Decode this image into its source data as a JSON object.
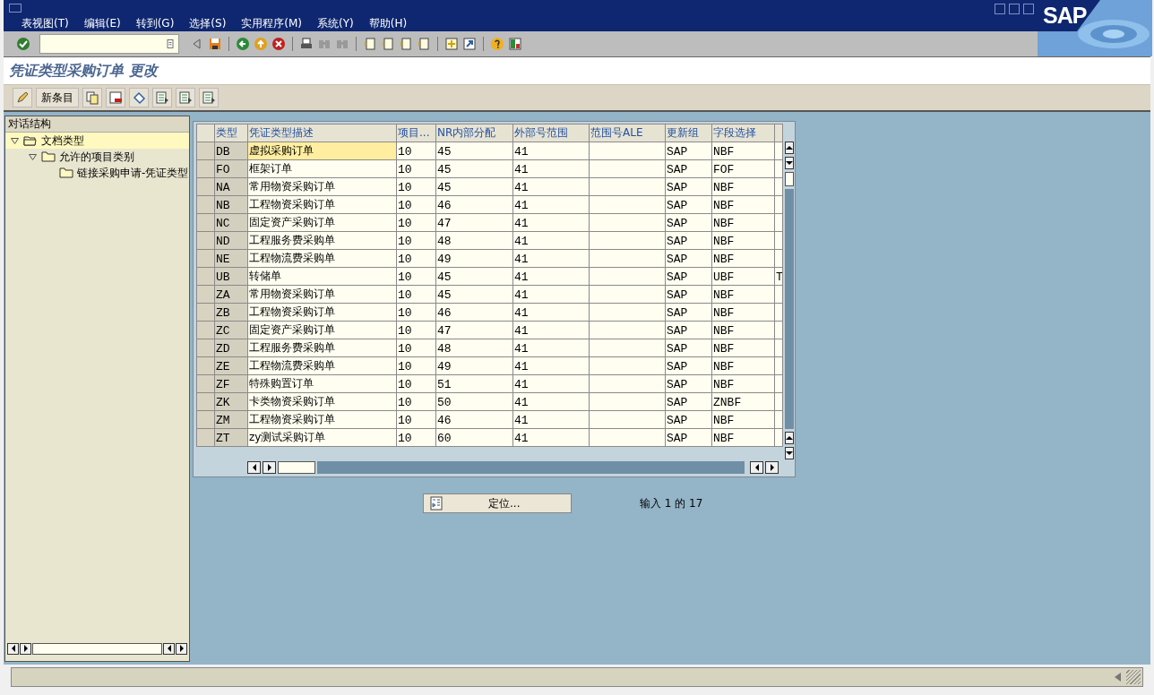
{
  "logo": "SAP",
  "menu": [
    "表视图(T)",
    "编辑(E)",
    "转到(G)",
    "选择(S)",
    "实用程序(M)",
    "系统(Y)",
    "帮助(H)"
  ],
  "title": "凭证类型采购订单 更改",
  "app_toolbar": {
    "button_label": "新条目"
  },
  "tree": {
    "title": "对话结构",
    "nodes": [
      {
        "label": "文档类型",
        "selected": true,
        "expanded": true,
        "children": [
          {
            "label": "允许的项目类别",
            "selected": false,
            "expanded": true,
            "children": [
              {
                "label": "链接采购申请-凭证类型",
                "selected": false
              }
            ]
          }
        ]
      }
    ]
  },
  "table": {
    "columns": [
      "类型",
      "凭证类型描述",
      "项目...",
      "NR内部分配",
      "外部号范围",
      "范围号ALE",
      "更新组",
      "字段选择"
    ],
    "rows": [
      {
        "cells": [
          "DB",
          "虚拟采购订单",
          "10",
          "45",
          "41",
          "",
          "SAP",
          "NBF",
          ""
        ],
        "focused": true
      },
      {
        "cells": [
          "FO",
          "框架订单",
          "10",
          "45",
          "41",
          "",
          "SAP",
          "FOF",
          ""
        ],
        "focused": false
      },
      {
        "cells": [
          "NA",
          "常用物资采购订单",
          "10",
          "45",
          "41",
          "",
          "SAP",
          "NBF",
          ""
        ],
        "focused": false
      },
      {
        "cells": [
          "NB",
          "工程物资采购订单",
          "10",
          "46",
          "41",
          "",
          "SAP",
          "NBF",
          ""
        ],
        "focused": false
      },
      {
        "cells": [
          "NC",
          "固定资产采购订单",
          "10",
          "47",
          "41",
          "",
          "SAP",
          "NBF",
          ""
        ],
        "focused": false
      },
      {
        "cells": [
          "ND",
          "工程服务费采购单",
          "10",
          "48",
          "41",
          "",
          "SAP",
          "NBF",
          ""
        ],
        "focused": false
      },
      {
        "cells": [
          "NE",
          "工程物流费采购单",
          "10",
          "49",
          "41",
          "",
          "SAP",
          "NBF",
          ""
        ],
        "focused": false
      },
      {
        "cells": [
          "UB",
          "转储单",
          "10",
          "45",
          "41",
          "",
          "SAP",
          "UBF",
          "T"
        ],
        "focused": false
      },
      {
        "cells": [
          "ZA",
          "常用物资采购订单",
          "10",
          "45",
          "41",
          "",
          "SAP",
          "NBF",
          ""
        ],
        "focused": false
      },
      {
        "cells": [
          "ZB",
          "工程物资采购订单",
          "10",
          "46",
          "41",
          "",
          "SAP",
          "NBF",
          ""
        ],
        "focused": false
      },
      {
        "cells": [
          "ZC",
          "固定资产采购订单",
          "10",
          "47",
          "41",
          "",
          "SAP",
          "NBF",
          ""
        ],
        "focused": false
      },
      {
        "cells": [
          "ZD",
          "工程服务费采购单",
          "10",
          "48",
          "41",
          "",
          "SAP",
          "NBF",
          ""
        ],
        "focused": false
      },
      {
        "cells": [
          "ZE",
          "工程物流费采购单",
          "10",
          "49",
          "41",
          "",
          "SAP",
          "NBF",
          ""
        ],
        "focused": false
      },
      {
        "cells": [
          "ZF",
          "特殊购置订单",
          "10",
          "51",
          "41",
          "",
          "SAP",
          "NBF",
          ""
        ],
        "focused": false
      },
      {
        "cells": [
          "ZK",
          "卡类物资采购订单",
          "10",
          "50",
          "41",
          "",
          "SAP",
          "ZNBF",
          ""
        ],
        "focused": false
      },
      {
        "cells": [
          "ZM",
          "工程物资采购订单",
          "10",
          "46",
          "41",
          "",
          "SAP",
          "NBF",
          ""
        ],
        "focused": false
      },
      {
        "cells": [
          "ZT",
          "zy测试采购订单",
          "10",
          "60",
          "41",
          "",
          "SAP",
          "NBF",
          ""
        ],
        "focused": false
      }
    ]
  },
  "position_button": "定位...",
  "entry_count": "输入 1 的 17"
}
